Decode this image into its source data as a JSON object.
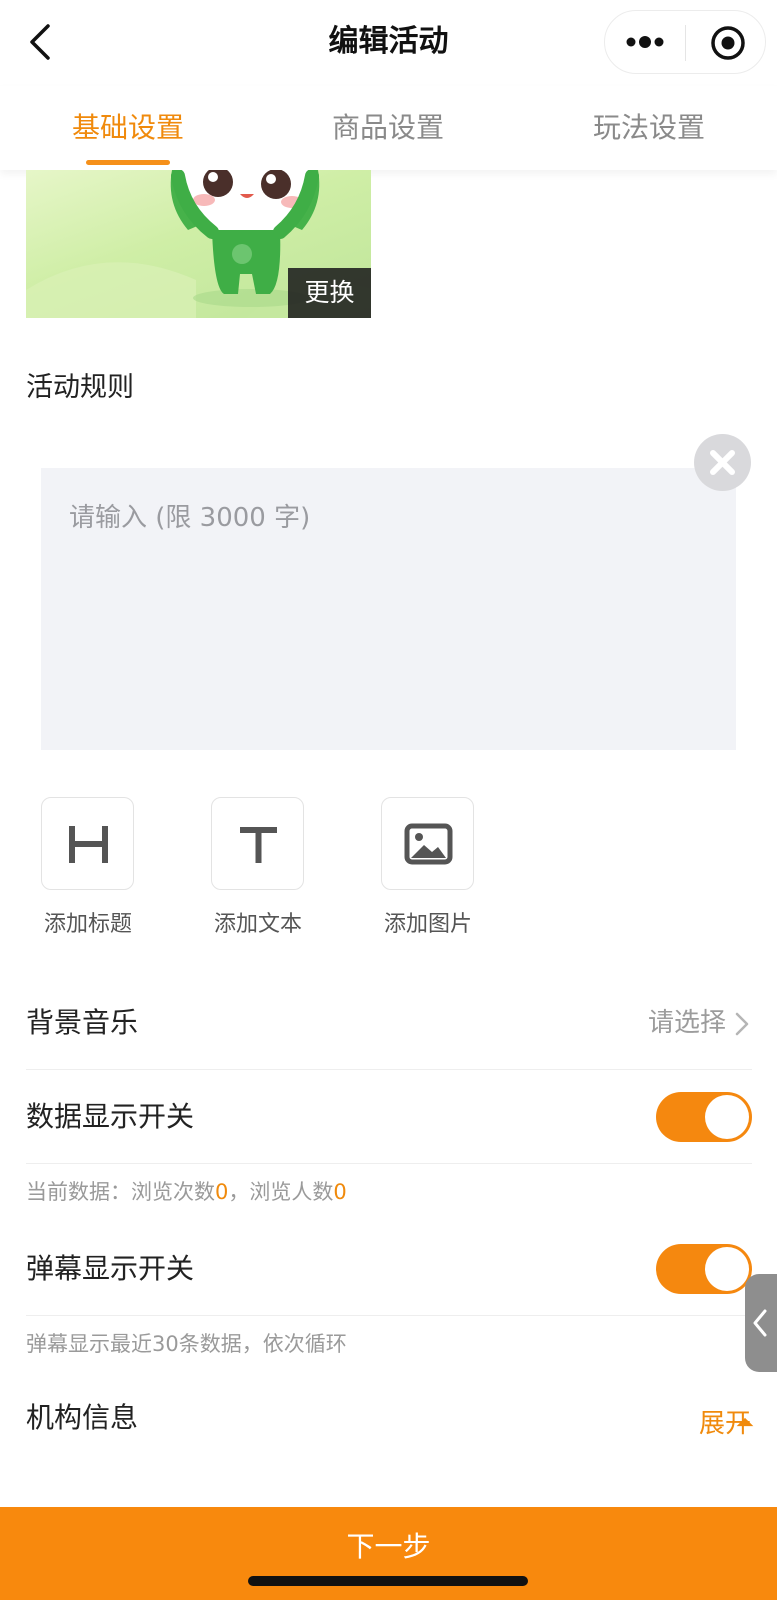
{
  "header": {
    "title": "编辑活动",
    "tabs": [
      {
        "label": "基础设置",
        "active": true
      },
      {
        "label": "商品设置",
        "active": false
      },
      {
        "label": "玩法设置",
        "active": false
      }
    ]
  },
  "cover": {
    "change_label": "更换"
  },
  "rules": {
    "title": "活动规则",
    "placeholder": "请输入 (限 3000 字)",
    "tools": [
      {
        "label": "添加标题",
        "icon": "heading-icon"
      },
      {
        "label": "添加文本",
        "icon": "text-icon"
      },
      {
        "label": "添加图片",
        "icon": "image-icon"
      }
    ]
  },
  "settings": {
    "music": {
      "label": "背景音乐",
      "value": "请选择"
    },
    "data_switch": {
      "label": "数据显示开关",
      "on": true
    },
    "data_note": {
      "prefix": "当前数据：浏览次数",
      "views": "0",
      "middle": "，浏览人数",
      "visitors": "0"
    },
    "barrage_switch": {
      "label": "弹幕显示开关",
      "on": true
    },
    "barrage_note": "弹幕显示最近30条数据，依次循环",
    "org": {
      "label": "机构信息",
      "action": "展开"
    }
  },
  "footer": {
    "next_label": "下一步"
  },
  "colors": {
    "accent": "#f08a0c",
    "button": "#f8890d",
    "editor_bg": "#f2f3f7"
  }
}
